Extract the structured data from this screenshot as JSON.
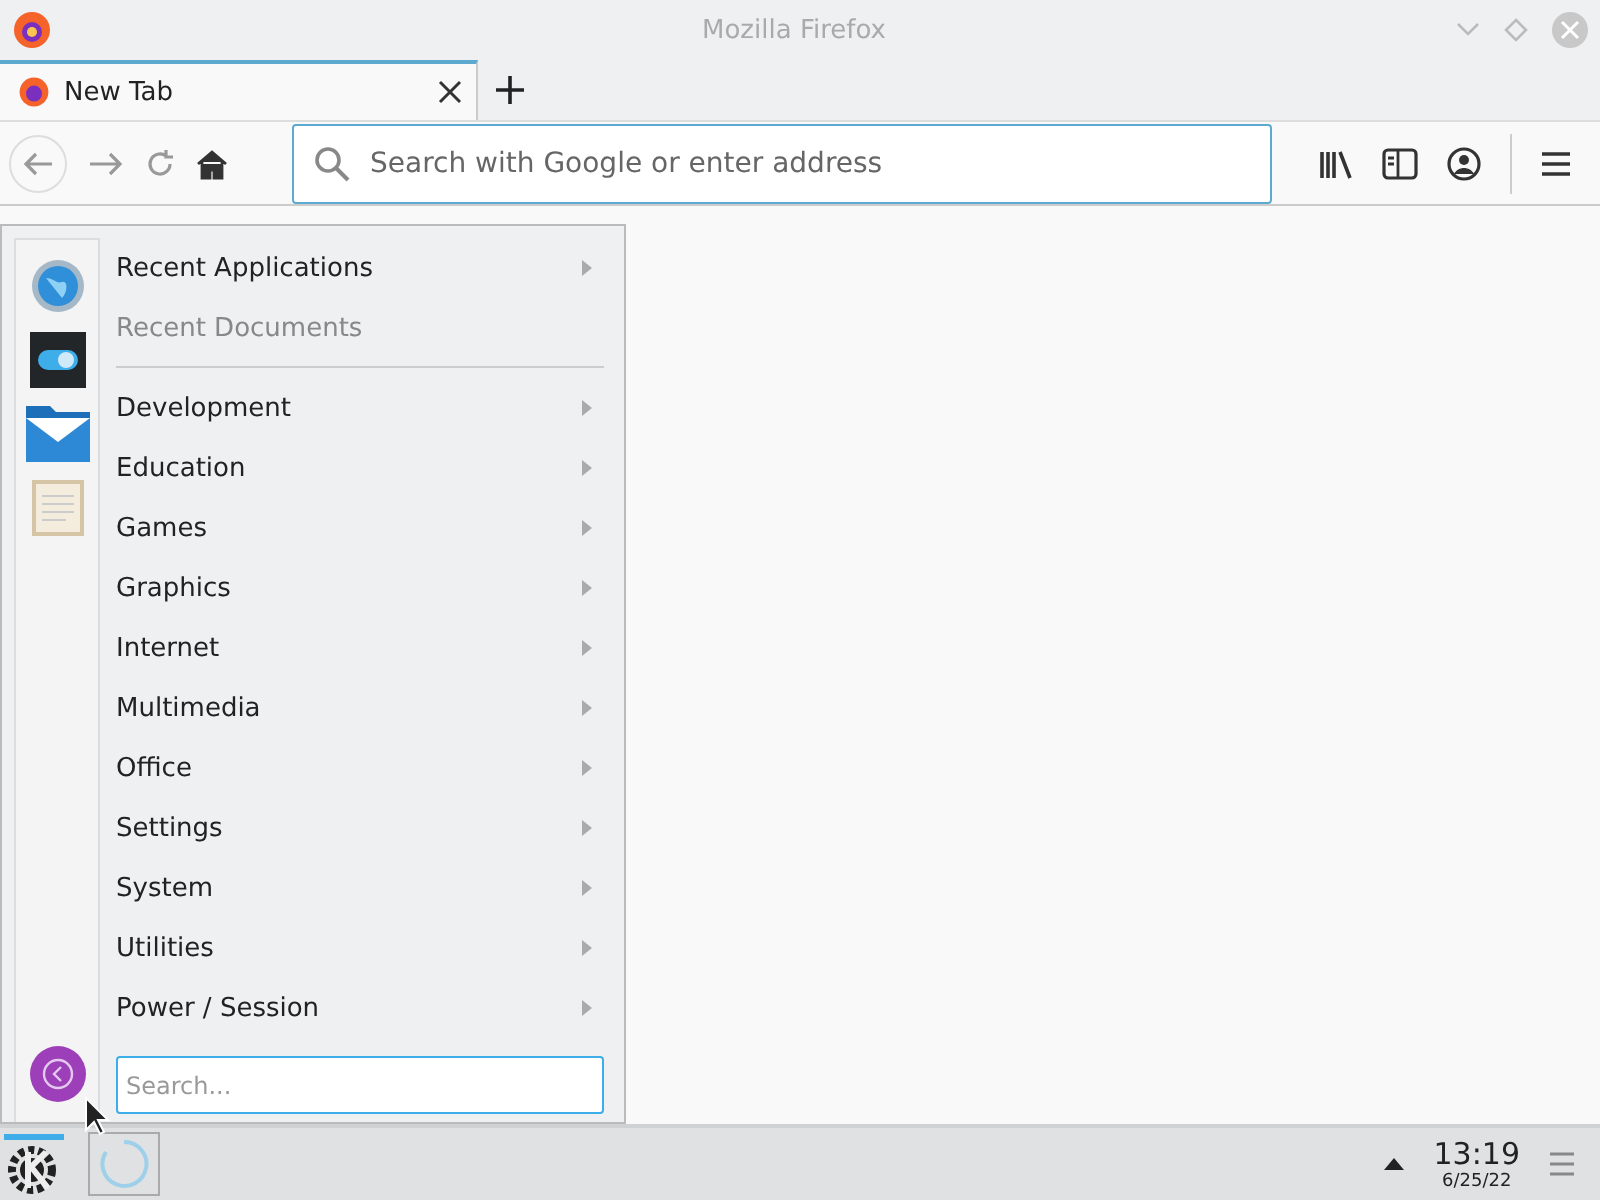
{
  "window": {
    "title": "Mozilla Firefox"
  },
  "tabs": [
    {
      "label": "New Tab",
      "selected": true
    }
  ],
  "address_bar": {
    "placeholder": "Search with Google or enter address"
  },
  "menu": {
    "items": [
      {
        "label": "Recent Applications",
        "disabled": false,
        "submenu": true
      },
      {
        "label": "Recent Documents",
        "disabled": true,
        "submenu": false
      },
      {
        "kind": "separator"
      },
      {
        "label": "Development",
        "disabled": false,
        "submenu": true
      },
      {
        "label": "Education",
        "disabled": false,
        "submenu": true
      },
      {
        "label": "Games",
        "disabled": false,
        "submenu": true
      },
      {
        "label": "Graphics",
        "disabled": false,
        "submenu": true
      },
      {
        "label": "Internet",
        "disabled": false,
        "submenu": true
      },
      {
        "label": "Multimedia",
        "disabled": false,
        "submenu": true
      },
      {
        "label": "Office",
        "disabled": false,
        "submenu": true
      },
      {
        "label": "Settings",
        "disabled": false,
        "submenu": true
      },
      {
        "label": "System",
        "disabled": false,
        "submenu": true
      },
      {
        "label": "Utilities",
        "disabled": false,
        "submenu": true
      },
      {
        "label": "Power / Session",
        "disabled": false,
        "submenu": true
      }
    ],
    "search": {
      "placeholder": "Search..."
    }
  },
  "taskbar": {
    "time": "13:19",
    "date": "6/25/22"
  }
}
